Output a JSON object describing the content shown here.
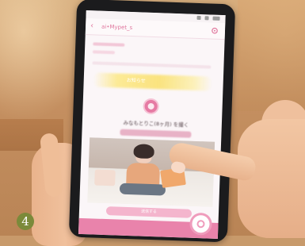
{
  "header": {
    "title": "ai•Mypet_s",
    "back_icon": "chevron-left-icon",
    "settings_icon": "gear-icon"
  },
  "banner": {
    "text": "お知らせ"
  },
  "message": {
    "title": "みなもとりこ(8ヶ月) を撮く"
  },
  "photo": {
    "subject": "baby-photo"
  },
  "cta": {
    "label": "送信する"
  },
  "bottom_nav": {
    "items": [
      "",
      "",
      ""
    ],
    "fab_icon": "heart-icon"
  },
  "step": {
    "number": "4"
  },
  "colors": {
    "brand_pink": "#e983ab",
    "banner_yellow": "#fae278",
    "step_badge": "#7b8a3a"
  }
}
